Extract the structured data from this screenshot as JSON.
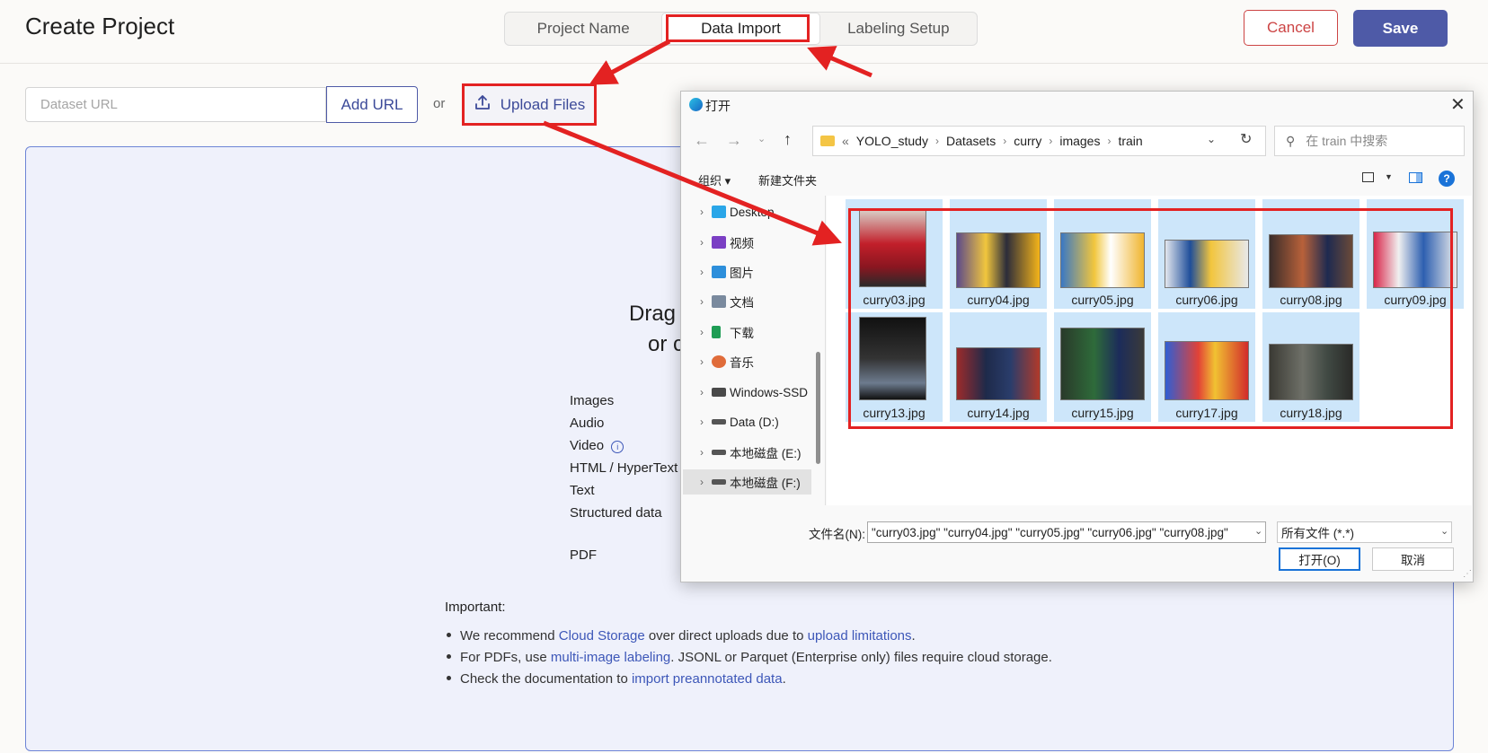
{
  "header": {
    "title": "Create Project",
    "tabs": [
      "Project Name",
      "Data Import",
      "Labeling Setup"
    ],
    "active_tab": "Data Import",
    "cancel_label": "Cancel",
    "save_label": "Save"
  },
  "import": {
    "url_placeholder": "Dataset URL",
    "add_url_label": "Add URL",
    "or_label": "or",
    "upload_label": "Upload Files"
  },
  "dropzone": {
    "line1": "Drag",
    "line2": "or c",
    "file_types": [
      "Images",
      "Audio",
      "Video",
      "HTML / HyperText",
      "Text",
      "Structured data",
      "PDF"
    ],
    "important_label": "Important:",
    "bullet1": {
      "a": "We recommend ",
      "link1": "Cloud Storage",
      "b": " over direct uploads due to ",
      "link2": "upload limitations",
      "c": "."
    },
    "bullet2": {
      "a": "For PDFs, use ",
      "link1": "multi-image labeling",
      "b": ". JSONL or Parquet (Enterprise only) files require cloud storage."
    },
    "bullet3": {
      "a": "Check the documentation to ",
      "link1": "import preannotated data",
      "b": "."
    }
  },
  "dialog": {
    "title": "打开",
    "path_prefix": "«",
    "path": [
      "YOLO_study",
      "Datasets",
      "curry",
      "images",
      "train"
    ],
    "search_placeholder": "在 train 中搜索",
    "organize_label": "组织 ▾",
    "new_folder_label": "新建文件夹",
    "nav_items": [
      "Desktop",
      "视频",
      "图片",
      "文档",
      "下载",
      "音乐",
      "Windows-SSD",
      "Data (D:)",
      "本地磁盘 (E:)",
      "本地磁盘 (F:)"
    ],
    "files": [
      "curry03.jpg",
      "curry04.jpg",
      "curry05.jpg",
      "curry06.jpg",
      "curry08.jpg",
      "curry09.jpg",
      "curry13.jpg",
      "curry14.jpg",
      "curry15.jpg",
      "curry17.jpg",
      "curry18.jpg"
    ],
    "filename_label": "文件名(N):",
    "filename_value": "\"curry03.jpg\" \"curry04.jpg\" \"curry05.jpg\" \"curry06.jpg\" \"curry08.jpg\"",
    "filetype_value": "所有文件 (*.*)",
    "open_label": "打开(O)",
    "cancel_label": "取消"
  },
  "colors": {
    "accent": "#4e5aa7",
    "annotation_red": "#e32222",
    "selection_blue": "#cde6fa",
    "link": "#3d57b8"
  }
}
